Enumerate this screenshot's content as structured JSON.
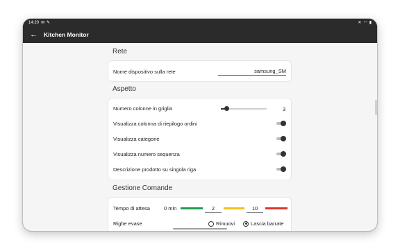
{
  "status_bar": {
    "time": "14:20"
  },
  "app_bar": {
    "title": "Kitchen Monitor"
  },
  "rete": {
    "title": "Rete",
    "device_name_label": "Nome dispositivo sulla rete",
    "device_name_value": "samsung_SM"
  },
  "aspetto": {
    "title": "Aspetto",
    "columns_label": "Numero colonne in griglia",
    "columns_value": "3",
    "columns_fraction": 0.12,
    "toggles": [
      {
        "label": "Visualizza colonna di riepilogo ordini",
        "on": true
      },
      {
        "label": "Visualizza categorie",
        "on": true
      },
      {
        "label": "Visualizza numero sequenza",
        "on": true
      },
      {
        "label": "Descrizione prodotto su singola riga",
        "on": true
      }
    ]
  },
  "gestione": {
    "title": "Gestione Comande",
    "wait_label": "Tempo di attesa",
    "wait_start": "0 min",
    "wait_threshold_1": "2",
    "wait_threshold_2": "10",
    "colors": {
      "green": "#1e9e4f",
      "yellow": "#f5c01a",
      "red": "#e0352b"
    },
    "evase_label": "Righe evase",
    "option_remove": "Rimuovi",
    "option_keep": "Lascia barrate",
    "selected": "Lascia barrate"
  }
}
